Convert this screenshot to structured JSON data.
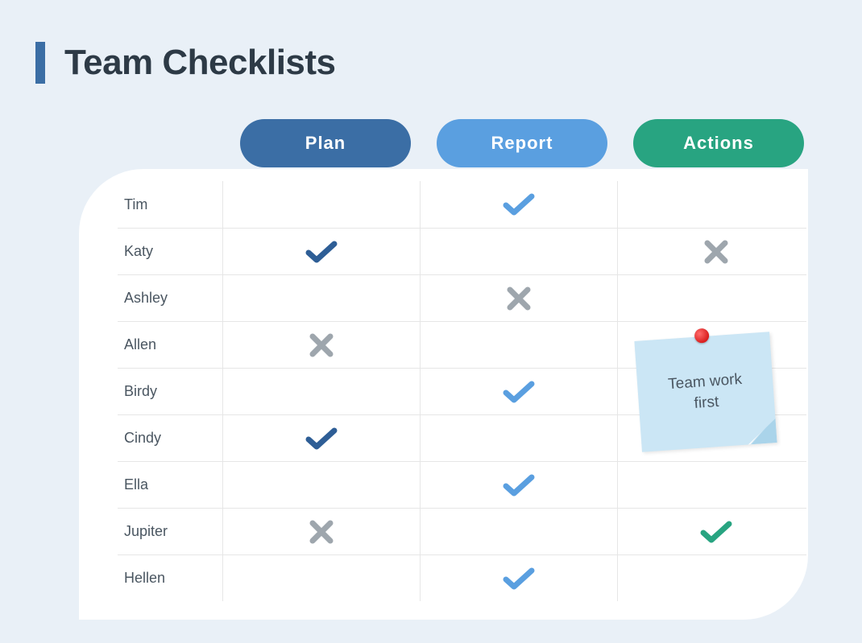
{
  "title": "Team Checklists",
  "columns": {
    "plan": {
      "label": "Plan",
      "color": "#3b6ea5"
    },
    "report": {
      "label": "Report",
      "color": "#5a9fe0"
    },
    "actions": {
      "label": "Actions",
      "color": "#28a481"
    }
  },
  "members": [
    {
      "name": "Tim",
      "plan": "",
      "report": "check",
      "actions": ""
    },
    {
      "name": "Katy",
      "plan": "check",
      "report": "",
      "actions": "cross"
    },
    {
      "name": "Ashley",
      "plan": "",
      "report": "cross",
      "actions": ""
    },
    {
      "name": "Allen",
      "plan": "cross",
      "report": "",
      "actions": ""
    },
    {
      "name": "Birdy",
      "plan": "",
      "report": "check",
      "actions": ""
    },
    {
      "name": "Cindy",
      "plan": "check",
      "report": "",
      "actions": ""
    },
    {
      "name": "Ella",
      "plan": "",
      "report": "check",
      "actions": ""
    },
    {
      "name": "Jupiter",
      "plan": "cross",
      "report": "",
      "actions": "check"
    },
    {
      "name": "Hellen",
      "plan": "",
      "report": "check",
      "actions": ""
    }
  ],
  "statusColors": {
    "plan_check": "#2e5e96",
    "report_check": "#5a9fe0",
    "actions_check": "#28a481",
    "cross": "#9ea6ad"
  },
  "note": {
    "line1": "Team work",
    "line2": "first"
  }
}
